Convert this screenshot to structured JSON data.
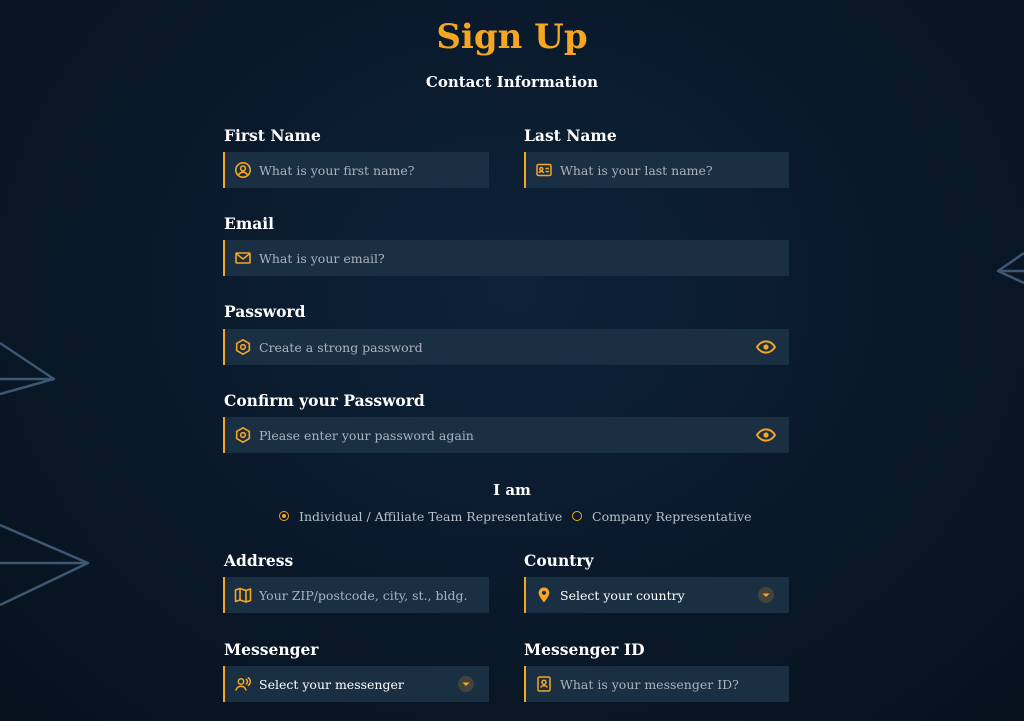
{
  "header": {
    "title": "Sign Up",
    "subtitle": "Contact Information"
  },
  "form": {
    "first_name": {
      "label": "First Name",
      "placeholder": "What is your first name?",
      "icon": "user-circle-icon"
    },
    "last_name": {
      "label": "Last Name",
      "placeholder": "What is your last name?",
      "icon": "id-card-icon"
    },
    "email": {
      "label": "Email",
      "placeholder": "What is your email?",
      "icon": "envelope-icon"
    },
    "password": {
      "label": "Password",
      "placeholder": "Create a strong password",
      "icon": "hexagon-lock-icon",
      "toggle_icon": "eye-icon"
    },
    "confirm_password": {
      "label": "Confirm your Password",
      "placeholder": "Please enter your password again",
      "icon": "hexagon-lock-icon",
      "toggle_icon": "eye-icon"
    },
    "role": {
      "label": "I am",
      "options": [
        {
          "label": "Individual / Affiliate Team Representative",
          "selected": true
        },
        {
          "label": "Company Representative",
          "selected": false
        }
      ]
    },
    "address": {
      "label": "Address",
      "placeholder": "Your ZIP/postcode, city, st., bldg.",
      "icon": "map-icon"
    },
    "country": {
      "label": "Country",
      "selected": "Select your country",
      "icon": "location-pin-icon"
    },
    "messenger": {
      "label": "Messenger",
      "selected": "Select your messenger",
      "icon": "user-voice-icon"
    },
    "messenger_id": {
      "label": "Messenger ID",
      "placeholder": "What is your messenger ID?",
      "icon": "id-badge-icon"
    }
  },
  "colors": {
    "accent": "#f5a623",
    "background": "#0a1a2c",
    "field_bg": "#1b2f43",
    "placeholder": "#aab3bd"
  }
}
